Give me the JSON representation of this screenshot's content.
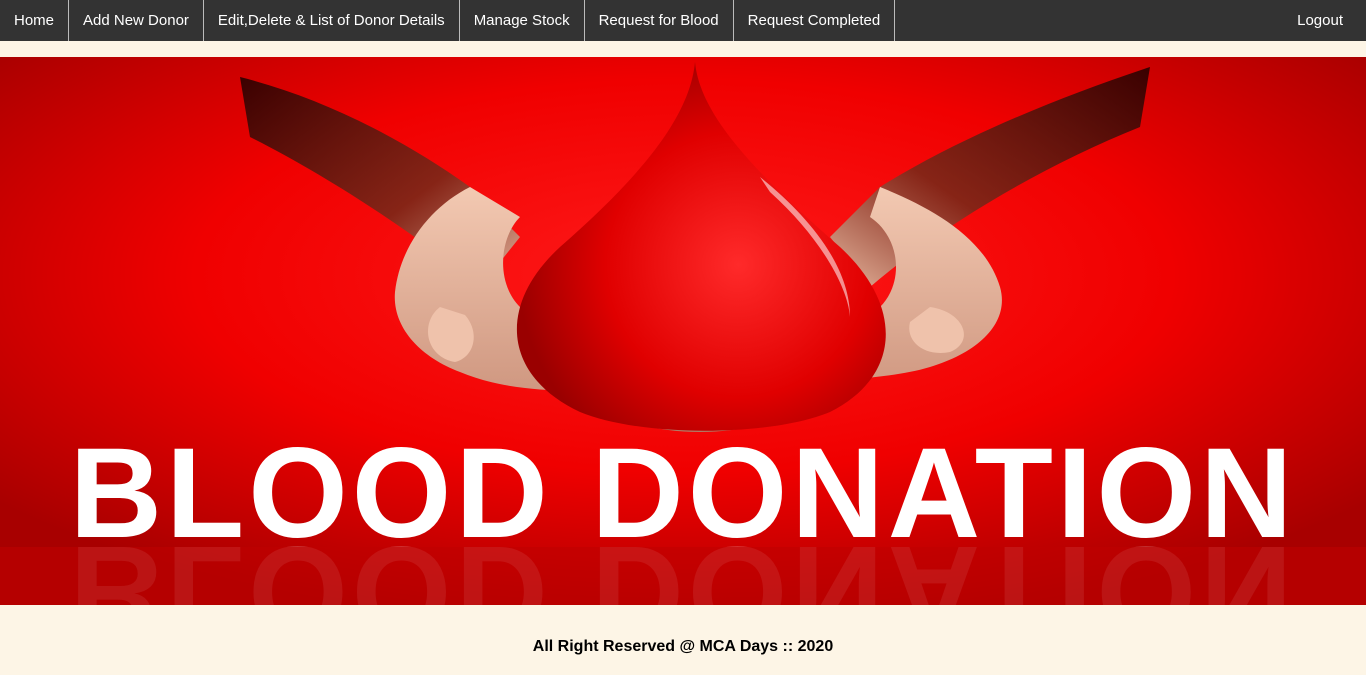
{
  "nav": {
    "items": [
      {
        "label": "Home"
      },
      {
        "label": "Add New Donor"
      },
      {
        "label": "Edit,Delete & List of Donor Details"
      },
      {
        "label": "Manage Stock"
      },
      {
        "label": "Request for Blood"
      },
      {
        "label": "Request Completed"
      }
    ],
    "logout_label": "Logout"
  },
  "banner": {
    "headline": "BLOOD DONATION"
  },
  "footer": {
    "text": "All Right Reserved @ MCA Days :: 2020"
  },
  "colors": {
    "navbar": "#333333",
    "page_background": "#fdf5e6",
    "banner_red": "#e00000"
  }
}
